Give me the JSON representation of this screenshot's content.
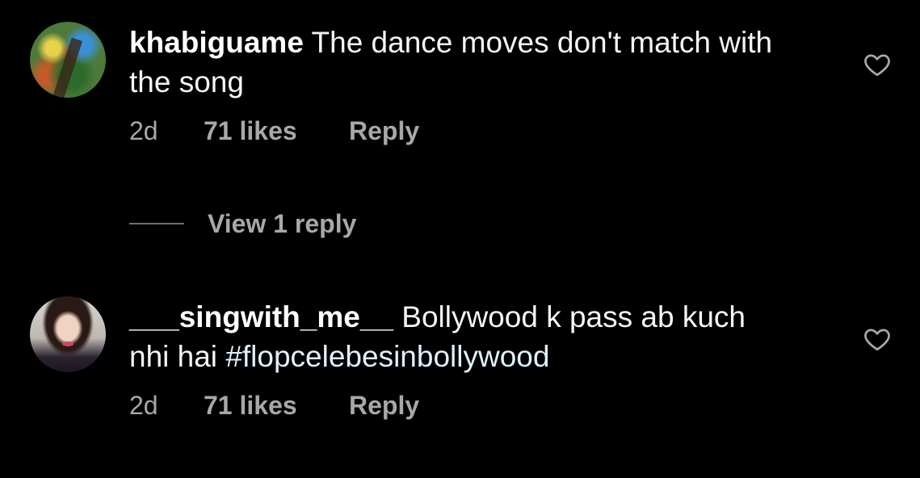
{
  "comments": [
    {
      "username": "khabiguame",
      "text": " The dance moves don't match with the song",
      "hashtag": "",
      "time": "2d",
      "likes": "71 likes",
      "reply_label": "Reply",
      "view_replies_label": "View 1 reply",
      "avatar_icon": "nature-photo-avatar",
      "like_icon": "heart-outline-icon"
    },
    {
      "username": "___singwith_me__",
      "text": " Bollywood k pass ab kuch nhi hai ",
      "hashtag": "#flopcelebesinbollywood",
      "time": "2d",
      "likes": "71 likes",
      "reply_label": "Reply",
      "avatar_icon": "portrait-photo-avatar",
      "like_icon": "heart-outline-icon"
    }
  ],
  "colors": {
    "background": "#000000",
    "primary_text": "#f5f5f5",
    "secondary_text": "#a8a8a8",
    "hashtag": "#e0f1ff",
    "divider": "#6e6e6e"
  }
}
